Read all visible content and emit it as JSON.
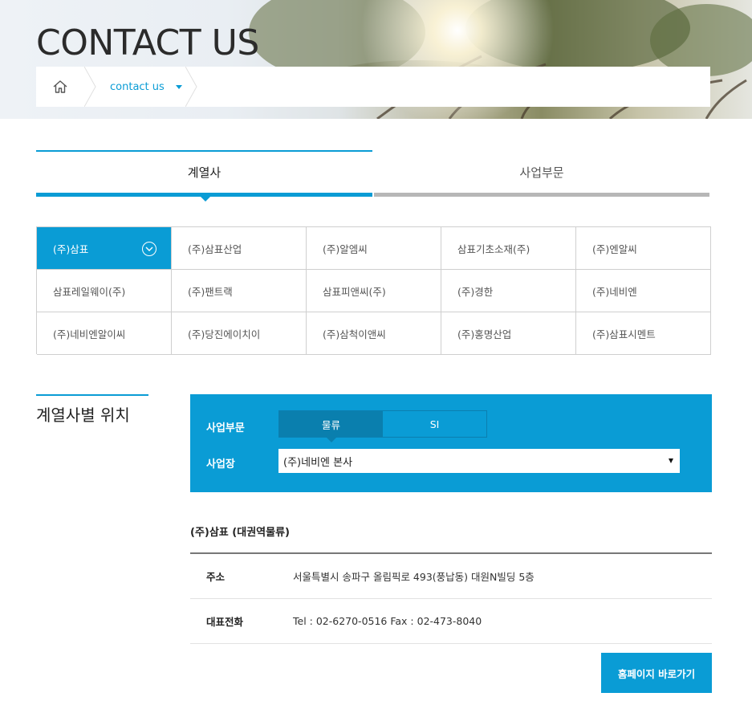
{
  "header": {
    "title": "CONTACT US",
    "breadcrumb": {
      "home_icon": "home-icon",
      "current": "contact us"
    }
  },
  "tabs": [
    {
      "label": "계열사",
      "active": true
    },
    {
      "label": "사업부문",
      "active": false
    }
  ],
  "affiliates": [
    {
      "name": "(주)삼표",
      "active": true
    },
    {
      "name": "(주)삼표산업",
      "active": false
    },
    {
      "name": "(주)알엠씨",
      "active": false
    },
    {
      "name": "삼표기초소재(주)",
      "active": false
    },
    {
      "name": "(주)엔알씨",
      "active": false
    },
    {
      "name": "삼표레일웨이(주)",
      "active": false
    },
    {
      "name": "(주)팬트랙",
      "active": false
    },
    {
      "name": "삼표피앤씨(주)",
      "active": false
    },
    {
      "name": "(주)경한",
      "active": false
    },
    {
      "name": "(주)네비엔",
      "active": false
    },
    {
      "name": "(주)네비엔알이씨",
      "active": false
    },
    {
      "name": "(주)당진에이치이",
      "active": false
    },
    {
      "name": "(주)삼척이앤씨",
      "active": false
    },
    {
      "name": "(주)홍명산업",
      "active": false
    },
    {
      "name": "(주)삼표시멘트",
      "active": false
    }
  ],
  "location": {
    "section_title": "계열사별 위치",
    "filter": {
      "division_label": "사업부문",
      "division_options": [
        "물류",
        "SI"
      ],
      "division_selected": "물류",
      "site_label": "사업장",
      "site_selected": "(주)네비엔 본사"
    },
    "office": {
      "name": "(주)삼표 (대권역물류)",
      "rows": [
        {
          "key": "주소",
          "value": "서울특별시 송파구 올림픽로 493(풍납동) 대원N빌딩 5층"
        },
        {
          "key": "대표전화",
          "value": "Tel : 02-6270-0516 Fax : 02-473-8040"
        }
      ]
    },
    "homepage_button": "홈페이지 바로가기"
  },
  "colors": {
    "accent": "#0a9cd5",
    "accent_dark": "#0a7fae",
    "tab_inactive_bar": "#b7b7b7"
  }
}
